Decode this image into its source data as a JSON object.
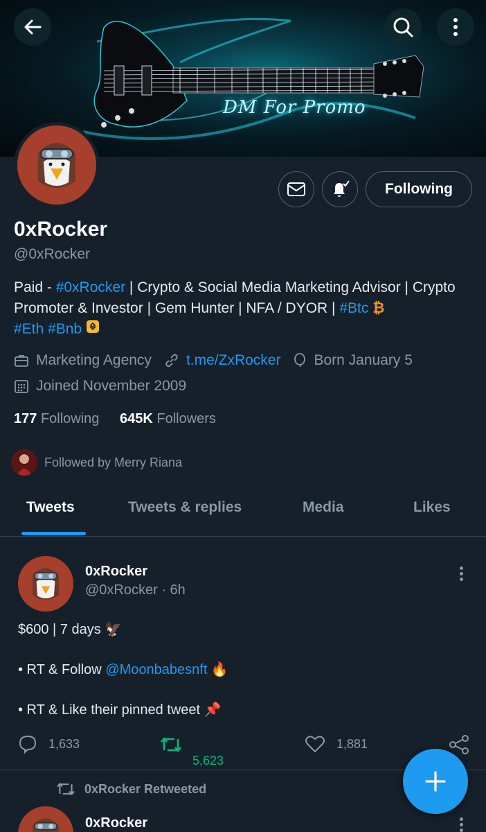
{
  "banner": {
    "promo_text": "DM For Promo"
  },
  "profile": {
    "name": "0xRocker",
    "handle": "@0xRocker",
    "bio": {
      "prefix": "Paid - ",
      "tag_main": "#0xRocker",
      "mid": " | Crypto & Social Media Marketing Advisor | Crypto Promoter & Investor | Gem Hunter | NFA / DYOR | ",
      "tag_btc": "#Btc",
      "btc_symbol": "₿",
      "tag_eth": "#Eth",
      "tag_bnb": "#Bnb"
    },
    "category": "Marketing Agency",
    "link": "t.me/ZxRocker",
    "born": "Born January 5",
    "joined": "Joined November 2009",
    "following_count": "177",
    "following_label": "Following",
    "followers_count": "645K",
    "followers_label": "Followers",
    "followed_by": "Followed by Merry Riana",
    "follow_button": "Following"
  },
  "tabs": [
    "Tweets",
    "Tweets & replies",
    "Media",
    "Likes"
  ],
  "tweet": {
    "name": "0xRocker",
    "handle": "@0xRocker",
    "time": "· 6h",
    "line1": "$600 | 7 days 🦅",
    "line2_prefix": "• RT & Follow ",
    "line2_mention": "@Moonbabesnft",
    "line2_suffix": " 🔥",
    "line3": "• RT & Like their pinned tweet 📌",
    "replies": "1,633",
    "retweets": "5,623",
    "likes": "1,881"
  },
  "retweet_notice": "0xRocker Retweeted",
  "next_tweet": {
    "name": "0xRocker"
  },
  "colors": {
    "accent": "#1d9bf0",
    "background": "#15202b",
    "retweet": "#00ba7c",
    "muted": "#8b98a5"
  }
}
